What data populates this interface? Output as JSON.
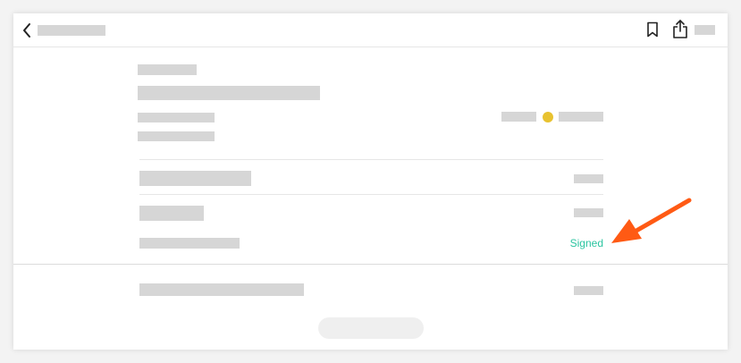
{
  "row_status": {
    "label": "Signed",
    "color": "#2bc4a0"
  },
  "header_status_dot": {
    "color": "#e8c230"
  },
  "icons": {
    "back": "chevron-left-icon",
    "bookmark": "bookmark-icon",
    "share": "share-icon"
  },
  "annotation": {
    "arrow_color": "#ff5a14"
  }
}
